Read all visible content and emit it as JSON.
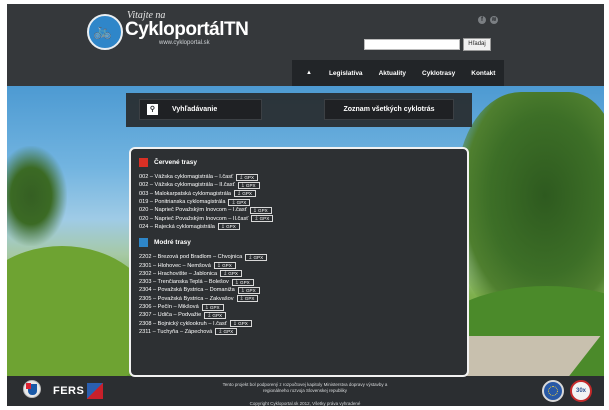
{
  "header": {
    "welcome": "Vitajte na",
    "site_name": "CykloportálTN",
    "site_url": "www.cykloportal.sk",
    "social": {
      "facebook": "f",
      "rss": "≋"
    },
    "search": {
      "value": "",
      "button": "Hľadaj"
    }
  },
  "nav": {
    "home_icon": "▲",
    "items": [
      "Legislatíva",
      "Aktuality",
      "Cyklotrasy",
      "Kontakt"
    ]
  },
  "search_bar": {
    "search_label": "Vyhľadávanie",
    "search_icon": "search-icon",
    "list_label": "Zoznam všetkých cyklotrás"
  },
  "gpx_label": "GPX",
  "gpx_icon": "download-icon",
  "red_routes": {
    "title": "Červené trasy",
    "color": "#d93025",
    "items": [
      "002 – Vážska cyklomagistrála – I.časť",
      "002 – Vážska cyklomagistrála – II.časť",
      "003 – Malokarpatská cyklomagistrála",
      "019 – Ponitrianska cyklomagistrála",
      "020 – Naprieč Považským Inovcom – I.časť",
      "020 – Naprieč Považským Inovcom – II.časť",
      "024 – Rajecká cyklomagistrála"
    ]
  },
  "blue_routes": {
    "title": "Modré trasy",
    "color": "#2e86c8",
    "items": [
      "2202 – Brezová pod Bradlom – Chvojnica",
      "2301 – Hlohovec – Nemšová",
      "2302 – Hrachovište – Jablonica",
      "2303 – Trenčianska Teplá – Bolešov",
      "2304 – Považská Bystrica – Domaniža",
      "2305 – Považská Bystrica – Zakvašov",
      "2306 – Pečín – Mikšová",
      "2307 – Udiča – Podvažie",
      "2308 – Bojnický cyklookruh – I.časť",
      "2311 – Tuchyňa – Zápechová"
    ]
  },
  "footer": {
    "text": "Tento projekt bol podporený z rozpočtovej kapitoly Ministerstva dopravy výstavby a regionálneho rozvoja Slovenskej republiky",
    "copyright": "Copyright Cykloportal.sk 2012, Všetky práva vyhradené",
    "fers": "FERS",
    "badge_30": "30x"
  }
}
